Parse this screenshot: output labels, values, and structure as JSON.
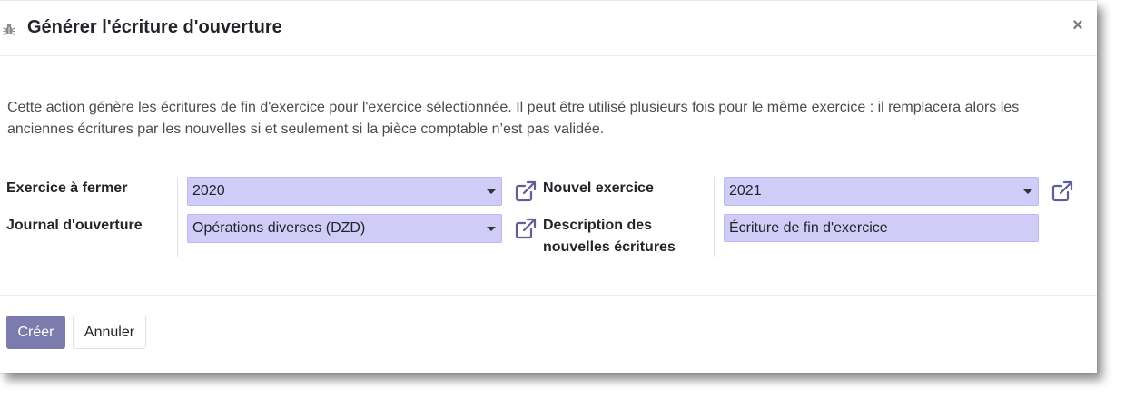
{
  "dialog": {
    "title": "Générer l'écriture d'ouverture",
    "close_label": "×"
  },
  "description": "Cette action génère les écritures de fin d'exercice pour l'exercice sélectionnée. Il peut être utilisé plusieurs fois pour le même exercice : il remplacera alors les anciennes écritures par les nouvelles si et seulement si la pièce comptable n’est pas validée.",
  "form": {
    "fiscal_year_to_close": {
      "label": "Exercice à fermer",
      "value": "2020"
    },
    "opening_journal": {
      "label": "Journal d'ouverture",
      "value": "Opérations diverses (DZD)"
    },
    "new_fiscal_year": {
      "label": "Nouvel exercice",
      "value": "2021"
    },
    "new_entries_description": {
      "label_line1": "Description des",
      "label_line2": "nouvelles écritures",
      "value": "Écriture de fin d'exercice"
    }
  },
  "footer": {
    "create_label": "Créer",
    "cancel_label": "Annuler"
  },
  "colors": {
    "primary": "#7c7bad",
    "field_bg": "#d0ccf7",
    "icon": "#5f5e97"
  },
  "icons": {
    "header": "bug-icon",
    "external": "external-link-icon"
  }
}
